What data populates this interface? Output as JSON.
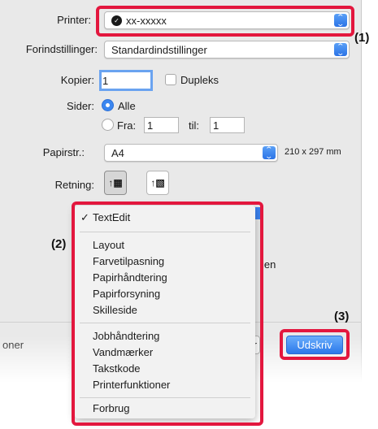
{
  "dialog": {
    "printer": {
      "label": "Printer:",
      "value": "xx-xxxxx"
    },
    "presets": {
      "label": "Forindstillinger:",
      "value": "Standardindstillinger"
    },
    "copies": {
      "label": "Kopier:",
      "value": "1",
      "duplex_label": "Dupleks"
    },
    "pages": {
      "label": "Sider:",
      "all_label": "Alle",
      "from_label": "Fra:",
      "from_value": "1",
      "to_label": "til:",
      "to_value": "1"
    },
    "paper_size": {
      "label": "Papirstr.:",
      "value": "A4",
      "dimensions": "210 x 297 mm"
    },
    "orientation": {
      "label": "Retning:",
      "portrait_icon": "portrait-orientation-icon",
      "landscape_icon": "landscape-orientation-icon"
    },
    "obscured_text": {
      "right": "ien",
      "bottom_left": "oner",
      "button_r": "r"
    },
    "print_button": "Udskriv"
  },
  "menu": {
    "checked_item": "TextEdit",
    "groups": [
      [
        "Layout",
        "Farvetilpasning",
        "Papirhåndtering",
        "Papirforsyning",
        "Skilleside"
      ],
      [
        "Jobhåndtering",
        "Vandmærker",
        "Takstkode",
        "Printerfunktioner"
      ],
      [
        "Forbrug"
      ]
    ]
  },
  "callouts": {
    "c1": "(1)",
    "c2": "(2)",
    "c3": "(3)"
  },
  "colors": {
    "callout": "#e3173e",
    "accent": "#2c78ea"
  }
}
